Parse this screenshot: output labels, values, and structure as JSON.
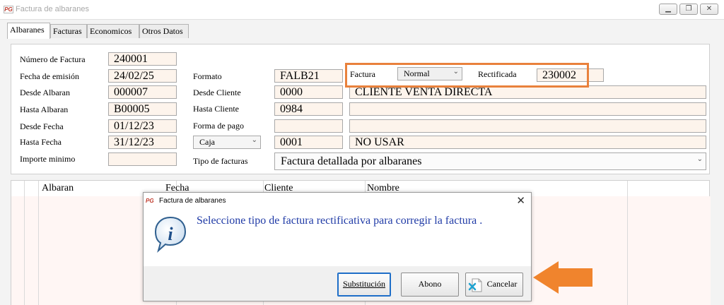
{
  "window": {
    "logo": "PG",
    "title": "Factura de albaranes",
    "controls": [
      "minimize-icon",
      "restore-icon",
      "close-icon"
    ]
  },
  "tabs": [
    "Albaranes",
    "Facturas",
    "Economicos",
    "Otros Datos"
  ],
  "form": {
    "labels": {
      "numero_factura": "Número de Factura",
      "fecha_emision": "Fecha de emisión",
      "desde_albaran": "Desde Albaran",
      "hasta_albaran": "Hasta Albaran",
      "desde_fecha": "Desde Fecha",
      "hasta_fecha": "Hasta Fecha",
      "importe_minimo": "Importe minimo",
      "formato": "Formato",
      "desde_cliente": "Desde Cliente",
      "hasta_cliente": "Hasta Cliente",
      "forma_pago": "Forma de pago",
      "tipo_facturas": "Tipo de facturas",
      "factura": "Factura",
      "rectificada": "Rectificada"
    },
    "values": {
      "numero_factura": "240001",
      "fecha_emision": "24/02/25",
      "desde_albaran": "000007",
      "hasta_albaran": "B00005",
      "desde_fecha": "01/12/23",
      "hasta_fecha": "31/12/23",
      "importe_minimo": "",
      "formato": "FALB21",
      "desde_cliente": "0000",
      "desde_cliente_nombre": "CLIENTE VENTA DIRECTA",
      "hasta_cliente": "0984",
      "hasta_cliente_nombre": "",
      "forma_pago": "",
      "forma_pago_nombre": "",
      "caja_code": "0001",
      "caja_nombre": "NO USAR",
      "caja_select": "Caja",
      "tipo_facturas": "Factura detallada por albaranes",
      "factura_tipo": "Normal",
      "rectificada": "230002"
    },
    "highlight_color": "#e9813c"
  },
  "table": {
    "columns": [
      "Albaran",
      "Fecha",
      "Cliente",
      "Nombre"
    ]
  },
  "dialog": {
    "logo": "PG",
    "title": "Factura de albaranes",
    "message": "Seleccione tipo de factura rectificativa para corregir la factura .",
    "icon": "info-icon",
    "buttons": {
      "substitution": "Substitución",
      "abono": "Abono",
      "cancelar": "Cancelar"
    }
  },
  "annotation": {
    "arrow_color": "#f0842d"
  }
}
